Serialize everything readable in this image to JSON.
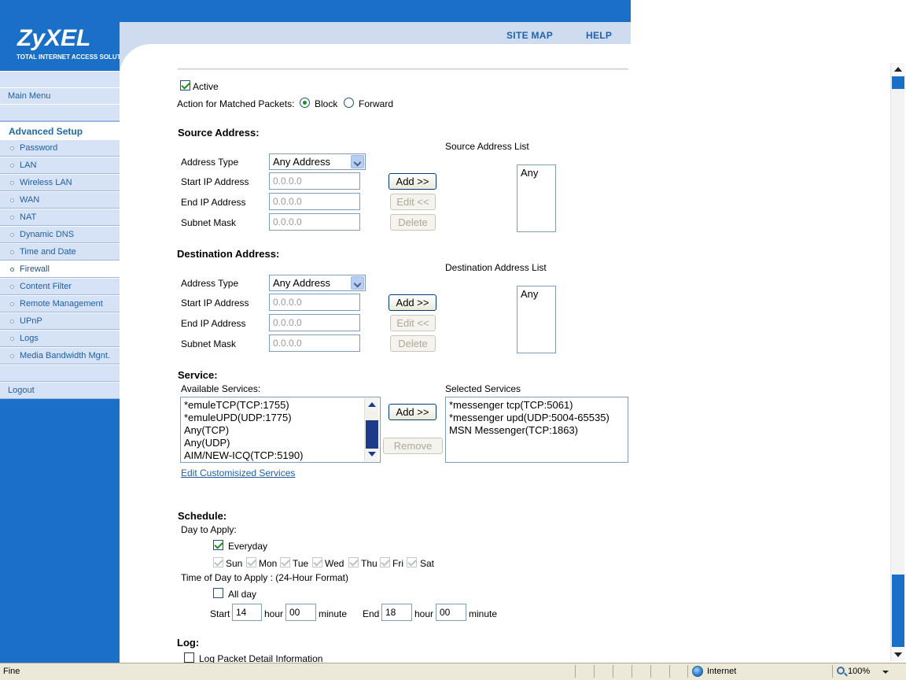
{
  "brand": {
    "logo": "ZyXEL",
    "tagline": "TOTAL INTERNET ACCESS SOLUTION"
  },
  "top_nav": {
    "site_map": "SITE MAP",
    "help": "HELP"
  },
  "sidebar": {
    "main_menu": "Main Menu",
    "section_header": "Advanced Setup",
    "items": [
      {
        "label": "Password"
      },
      {
        "label": "LAN"
      },
      {
        "label": "Wireless LAN"
      },
      {
        "label": "WAN"
      },
      {
        "label": "NAT"
      },
      {
        "label": "Dynamic DNS"
      },
      {
        "label": "Time and Date"
      },
      {
        "label": "Firewall",
        "active": true
      },
      {
        "label": "Content Filter"
      },
      {
        "label": "Remote Management"
      },
      {
        "label": "UPnP"
      },
      {
        "label": "Logs"
      },
      {
        "label": "Media Bandwidth Mgnt."
      }
    ],
    "logout": "Logout"
  },
  "rule": {
    "active_label": "Active",
    "active_checked": true,
    "action_label": "Action for Matched Packets:",
    "action_options": [
      "Block",
      "Forward"
    ],
    "action_selected": "Block"
  },
  "source": {
    "title": "Source Address:",
    "list_title": "Source Address List",
    "address_type_label": "Address Type",
    "address_type_value": "Any Address",
    "start_ip_label": "Start IP Address",
    "start_ip_value": "0.0.0.0",
    "end_ip_label": "End IP Address",
    "end_ip_value": "0.0.0.0",
    "subnet_label": "Subnet Mask",
    "subnet_value": "0.0.0.0",
    "add_button": "Add >>",
    "edit_button": "Edit <<",
    "delete_button": "Delete",
    "list_items": [
      "Any"
    ]
  },
  "destination": {
    "title": "Destination Address:",
    "list_title": "Destination Address List",
    "address_type_label": "Address Type",
    "address_type_value": "Any Address",
    "start_ip_label": "Start IP Address",
    "start_ip_value": "0.0.0.0",
    "end_ip_label": "End IP Address",
    "end_ip_value": "0.0.0.0",
    "subnet_label": "Subnet Mask",
    "subnet_value": "0.0.0.0",
    "add_button": "Add >>",
    "edit_button": "Edit <<",
    "delete_button": "Delete",
    "list_items": [
      "Any"
    ]
  },
  "service": {
    "title": "Service:",
    "available_label": "Available Services:",
    "available": [
      "*emuleTCP(TCP:1755)",
      "*emuleUPD(UDP:1775)",
      "Any(TCP)",
      "Any(UDP)",
      "AIM/NEW-ICQ(TCP:5190)"
    ],
    "selected_label": "Selected Services",
    "selected": [
      "*messenger tcp(TCP:5061)",
      "*messenger upd(UDP:5004-65535)",
      "MSN Messenger(TCP:1863)"
    ],
    "add_button": "Add >>",
    "remove_button": "Remove",
    "edit_link": "Edit Customisized Services"
  },
  "schedule": {
    "title": "Schedule:",
    "day_label": "Day to Apply:",
    "everyday_label": "Everyday",
    "everyday_checked": true,
    "days": [
      "Sun",
      "Mon",
      "Tue",
      "Wed",
      "Thu",
      "Fri",
      "Sat"
    ],
    "time_label": "Time of Day to Apply : (24-Hour Format)",
    "allday_label": "All day",
    "allday_checked": false,
    "start_label": "Start",
    "start_hour": "14",
    "start_minute": "00",
    "end_label": "End",
    "end_hour": "18",
    "end_minute": "00",
    "hour_label": "hour",
    "minute_label": "minute"
  },
  "log": {
    "title": "Log:",
    "detail_label": "Log Packet Detail Information"
  },
  "status_bar": {
    "status": "Fine",
    "zone": "Internet",
    "zoom": "100%"
  },
  "colors": {
    "brand_blue": "#1a6fc6",
    "menu_bg": "#d6e3f6",
    "link": "#215fa0"
  }
}
